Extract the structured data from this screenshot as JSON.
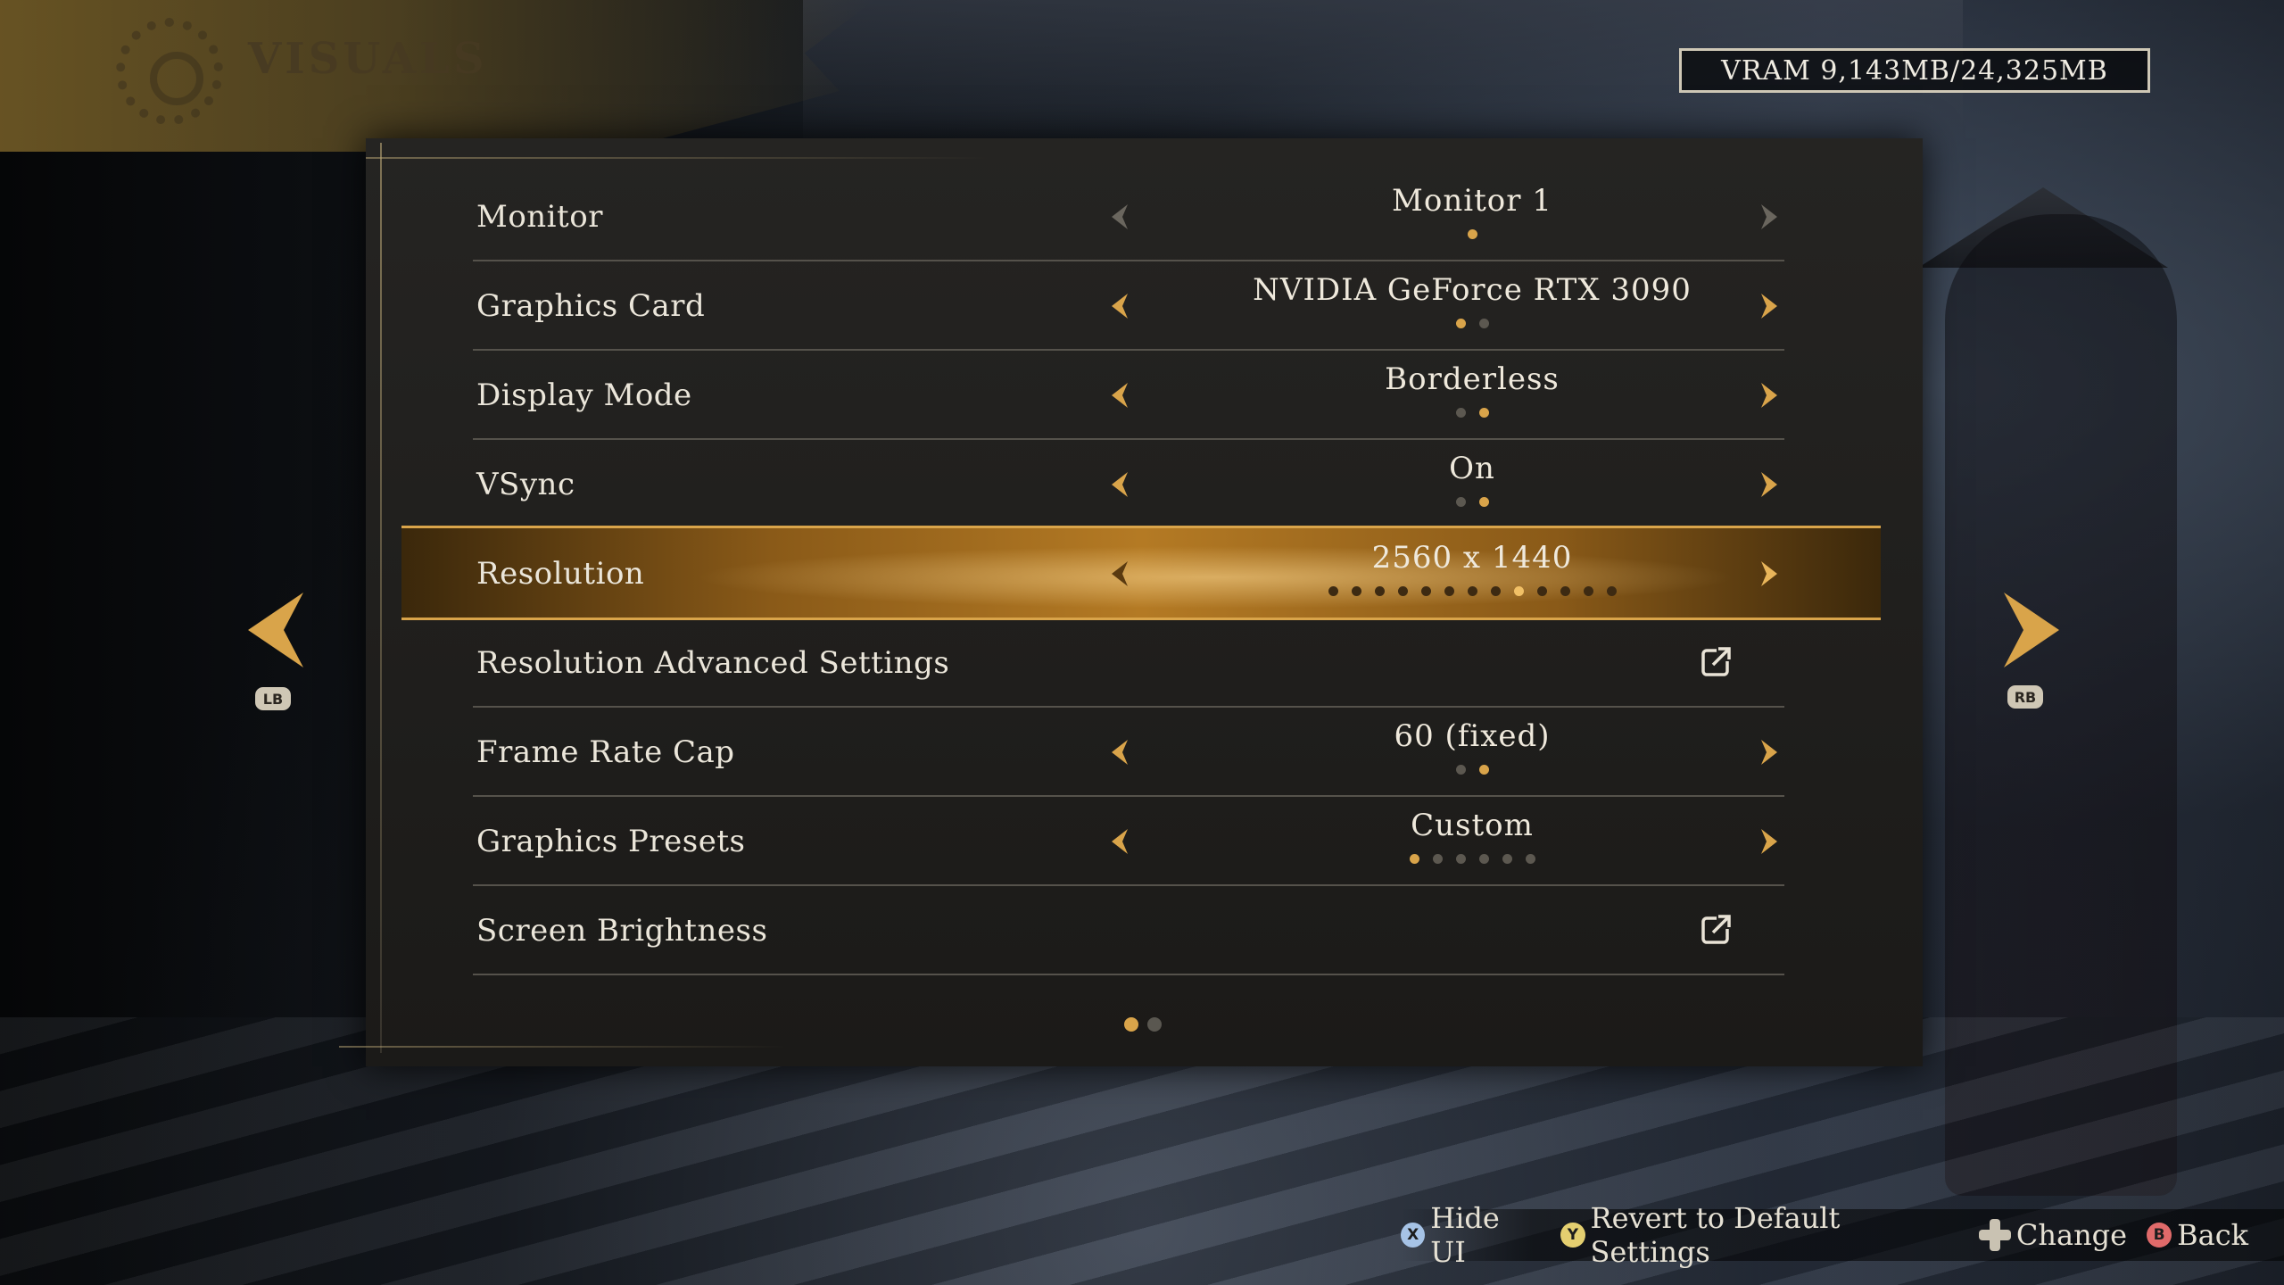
{
  "header": {
    "title": "VISUALS",
    "vram": "VRAM 9,143MB/24,325MB"
  },
  "colors": {
    "accent": "#d9a44a",
    "dot_inactive": "#5c5850",
    "panel_bg": "#222120"
  },
  "settings": [
    {
      "label": "Monitor",
      "type": "select",
      "value": "Monitor 1",
      "options_count": 1,
      "selected_index": 0,
      "arrows_active": false
    },
    {
      "label": "Graphics Card",
      "type": "select",
      "value": "NVIDIA GeForce RTX 3090",
      "options_count": 2,
      "selected_index": 0,
      "arrows_active": true
    },
    {
      "label": "Display Mode",
      "type": "select",
      "value": "Borderless",
      "options_count": 2,
      "selected_index": 1,
      "arrows_active": true
    },
    {
      "label": "VSync",
      "type": "select",
      "value": "On",
      "options_count": 2,
      "selected_index": 1,
      "arrows_active": true
    },
    {
      "label": "Resolution",
      "type": "select",
      "value": "2560 x 1440",
      "options_count": 13,
      "selected_index": 8,
      "arrows_active": true,
      "focused": true
    },
    {
      "label": "Resolution Advanced Settings",
      "type": "submenu",
      "icon": "open-external-icon"
    },
    {
      "label": "Frame Rate Cap",
      "type": "select",
      "value": "60 (fixed)",
      "options_count": 2,
      "selected_index": 1,
      "arrows_active": true
    },
    {
      "label": "Graphics Presets",
      "type": "select",
      "value": "Custom",
      "options_count": 6,
      "selected_index": 0,
      "arrows_active": true
    },
    {
      "label": "Screen Brightness",
      "type": "submenu",
      "icon": "open-external-icon"
    }
  ],
  "pagination": {
    "pages": 2,
    "current": 0
  },
  "side_nav": {
    "left_button": "LB",
    "right_button": "RB"
  },
  "footer": {
    "hints": [
      {
        "button": "X",
        "icon": "x-button-icon",
        "label": "Hide UI"
      },
      {
        "button": "Y",
        "icon": "y-button-icon",
        "label": "Revert to Default Settings"
      },
      {
        "button": "",
        "icon": "dpad-icon",
        "label": "Change"
      },
      {
        "button": "B",
        "icon": "b-button-icon",
        "label": "Back"
      }
    ]
  }
}
